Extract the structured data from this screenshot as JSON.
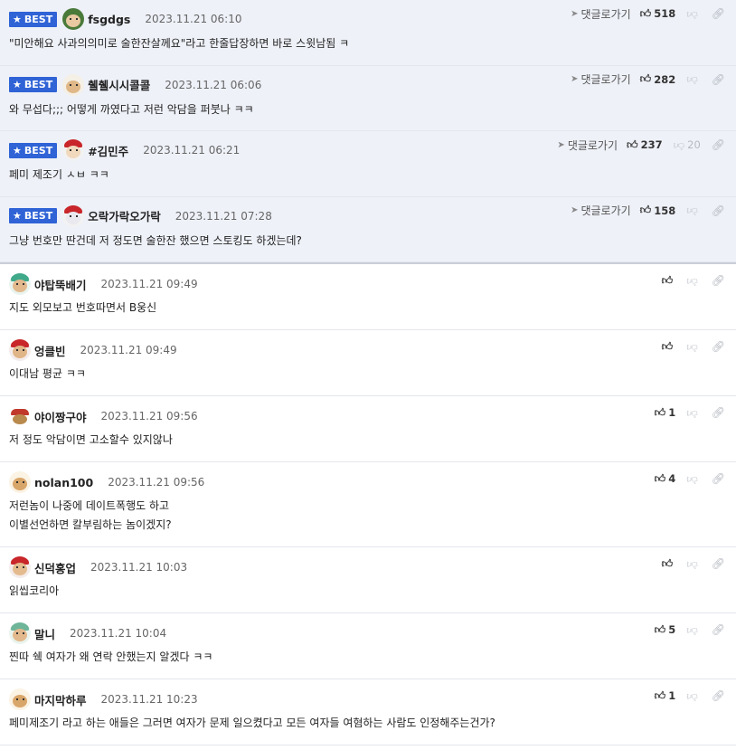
{
  "best_label": "BEST",
  "reply_label": "댓글로가기",
  "best_comments": [
    {
      "nick": "fsgdgs",
      "date": "2023.11.21 06:10",
      "text": "\"미안해요 사과의의미로 술한잔살께요\"라고 한줄답장하면 바로 스윗남됨 ㅋ",
      "likes": "518",
      "dislikes": ""
    },
    {
      "nick": "췔췔시시콜콜",
      "date": "2023.11.21 06:06",
      "text": "와 무섭다;;; 어떻게 까였다고 저런 악담을 퍼붓나 ㅋㅋ",
      "likes": "282",
      "dislikes": ""
    },
    {
      "nick": "#김민주",
      "date": "2023.11.21 06:21",
      "text": "페미 제조기 ㅅㅂ ㅋㅋ",
      "likes": "237",
      "dislikes": "20"
    },
    {
      "nick": "오락가락오가락",
      "date": "2023.11.21 07:28",
      "text": "그냥 번호만 딴건데 저 정도면 술한잔 했으면 스토킹도 하겠는데?",
      "likes": "158",
      "dislikes": ""
    }
  ],
  "comments": [
    {
      "nick": "야탑뚝배기",
      "date": "2023.11.21 09:49",
      "text": "지도 외모보고 번호따면서 B웅신",
      "likes": "",
      "dislikes": ""
    },
    {
      "nick": "엉클빈",
      "date": "2023.11.21 09:49",
      "text": "이대남 평균 ㅋㅋ",
      "likes": "",
      "dislikes": ""
    },
    {
      "nick": "야이짱구야",
      "date": "2023.11.21 09:56",
      "text": "저 정도 악담이면 고소할수 있지않나",
      "likes": "1",
      "dislikes": ""
    },
    {
      "nick": "nolan100",
      "date": "2023.11.21 09:56",
      "text": "저런놈이 나중에 데이트폭행도 하고",
      "text2": "이별선언하면 칼부림하는 놈이겠지?",
      "likes": "4",
      "dislikes": ""
    },
    {
      "nick": "신덕홍업",
      "date": "2023.11.21 10:03",
      "text": "읽씹코리아",
      "likes": "",
      "dislikes": ""
    },
    {
      "nick": "말니",
      "date": "2023.11.21 10:04",
      "text": "찐따 쉑 여자가 왜 연락 안했는지 알겠다 ㅋㅋ",
      "likes": "5",
      "dislikes": ""
    },
    {
      "nick": "마지막하루",
      "date": "2023.11.21 10:23",
      "text": "페미제조기 라고 하는 애들은 그러면 여자가 문제 일으켰다고 모든 여자들 여혐하는 사람도 인정해주는건가?",
      "likes": "1",
      "dislikes": ""
    }
  ]
}
